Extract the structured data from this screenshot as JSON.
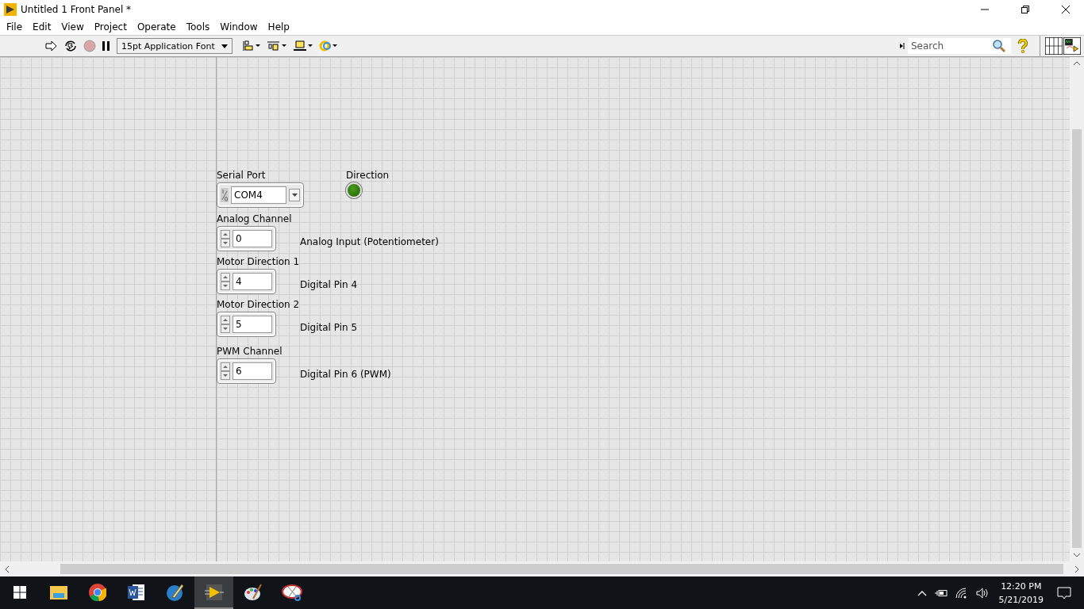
{
  "window": {
    "title": "Untitled 1 Front Panel *"
  },
  "menu": [
    "File",
    "Edit",
    "View",
    "Project",
    "Operate",
    "Tools",
    "Window",
    "Help"
  ],
  "toolbar": {
    "font": "15pt Application Font",
    "search": {
      "placeholder": "Search"
    }
  },
  "panel": {
    "controls": [
      {
        "kind": "ring",
        "label": "Serial Port",
        "value": "COM4"
      },
      {
        "kind": "led",
        "label": "Direction",
        "on": true
      },
      {
        "kind": "numeric",
        "label": "Analog Channel",
        "value": "0",
        "note": "Analog Input (Potentiometer)"
      },
      {
        "kind": "numeric",
        "label": "Motor Direction 1",
        "value": "4",
        "note": "Digital Pin 4"
      },
      {
        "kind": "numeric",
        "label": "Motor Direction 2",
        "value": "5",
        "note": "Digital Pin 5"
      },
      {
        "kind": "numeric",
        "label": "PWM Channel",
        "value": "6",
        "note": "Digital Pin 6 (PWM)"
      }
    ]
  },
  "taskbar": {
    "time": "12:20 PM",
    "date": "5/21/2019"
  }
}
